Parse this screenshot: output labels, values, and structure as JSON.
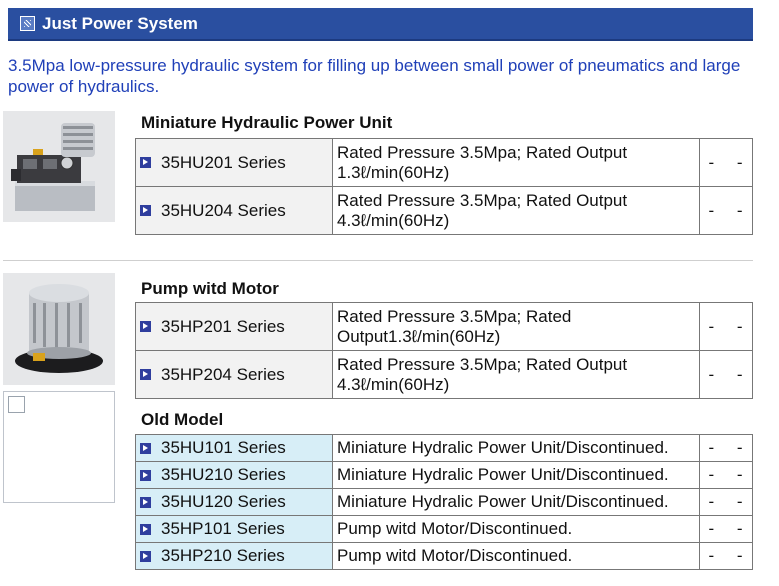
{
  "header": {
    "title": "Just Power System",
    "icon": "pattern-square-icon"
  },
  "intro": "3.5Mpa low-pressure hydraulic system for filling up between small power of pneumatics and large power of hydraulics.",
  "sections": [
    {
      "title": "Miniature Hydraulic Power Unit",
      "rows": [
        {
          "series": "35HU201 Series",
          "desc": "Rated Pressure 3.5Mpa; Rated Output 1.3ℓ/min(60Hz)",
          "dash": "- -"
        },
        {
          "series": "35HU204 Series",
          "desc": "Rated Pressure 3.5Mpa; Rated Output 4.3ℓ/min(60Hz)",
          "dash": "- -"
        }
      ]
    },
    {
      "title": "Pump witd Motor",
      "rows": [
        {
          "series": "35HP201 Series",
          "desc": "Rated Pressure 3.5Mpa; Rated Output1.3ℓ/min(60Hz)",
          "dash": "- -"
        },
        {
          "series": "35HP204 Series",
          "desc": "Rated Pressure 3.5Mpa; Rated Output 4.3ℓ/min(60Hz)",
          "dash": "- -"
        }
      ]
    },
    {
      "title": "Old Model",
      "rows": [
        {
          "series": "35HU101 Series",
          "desc": "Miniature Hydralic Power Unit/Discontinued.",
          "dash": "- -"
        },
        {
          "series": "35HU210 Series",
          "desc": "Miniature Hydralic Power Unit/Discontinued.",
          "dash": "- -"
        },
        {
          "series": "35HU120 Series",
          "desc": "Miniature Hydralic Power Unit/Discontinued.",
          "dash": "- -"
        },
        {
          "series": "35HP101 Series",
          "desc": "Pump witd Motor/Discontinued.",
          "dash": "- -"
        },
        {
          "series": "35HP210 Series",
          "desc": "Pump witd Motor/Discontinued.",
          "dash": "- -"
        }
      ]
    }
  ]
}
